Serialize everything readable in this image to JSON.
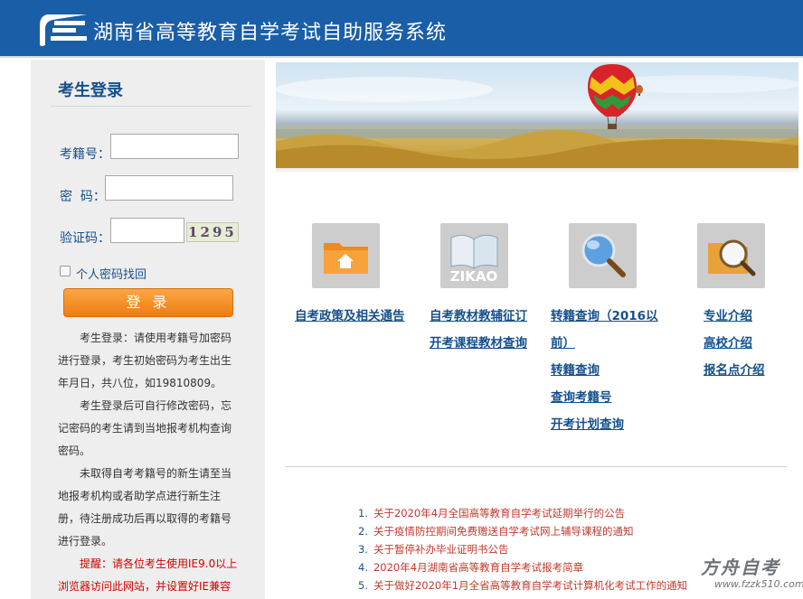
{
  "header": {
    "title": "湖南省高等教育自学考试自助服务系统"
  },
  "login": {
    "title": "考生登录",
    "exam_number_label": "考籍号：",
    "password_label": "密  码：",
    "captcha_label": "验证码：",
    "captcha_text": "1295",
    "recover_label": "个人密码找回",
    "login_button": "登 录",
    "notices": [
      "考生登录：请使用考籍号加密码进行登录，考生初始密码为考生出生年月日，共八位，如19810809。",
      "考生登录后可自行修改密码，忘记密码的考生请到当地报考机构查询密码。",
      "未取得自考考籍号的新生请至当地报考机构或者助学点进行新生注册，待注册成功后再以取得的考籍号进行登录。",
      "提醒：请各位考生使用IE9.0以上浏览器访问此网站，并设置好IE兼容"
    ]
  },
  "quick": {
    "zikao_text": "ZIKAO",
    "col1": [
      "自考政策及相关通告"
    ],
    "col2": [
      "自考教材教辅征订",
      "开考课程教材查询"
    ],
    "col3": [
      "转籍查询（2016以",
      "前）",
      "转籍查询",
      "查询考籍号",
      "开考计划查询"
    ],
    "col4": [
      "专业介绍",
      "高校介绍",
      "报名点介绍"
    ]
  },
  "news": [
    {
      "num": "1.",
      "text": "关于2020年4月全国高等教育自学考试延期举行的公告"
    },
    {
      "num": "2.",
      "text": "关于疫情防控期间免费赠送自学考试网上辅导课程的通知"
    },
    {
      "num": "3.",
      "text": "关于暂停补办毕业证明书公告"
    },
    {
      "num": "4.",
      "text": "2020年4月湖南省高等教育自学考试报考简章"
    },
    {
      "num": "5.",
      "text": "关于做好2020年1月全省高等教育自学考试计算机化考试工作的通知"
    }
  ],
  "watermark": {
    "brand": "方舟自考",
    "url": "www.fzzk510.com"
  },
  "colors": {
    "header_bg": "#1a5ea8",
    "link": "#16508c",
    "news": "#c0392b",
    "button": "#f39226"
  }
}
